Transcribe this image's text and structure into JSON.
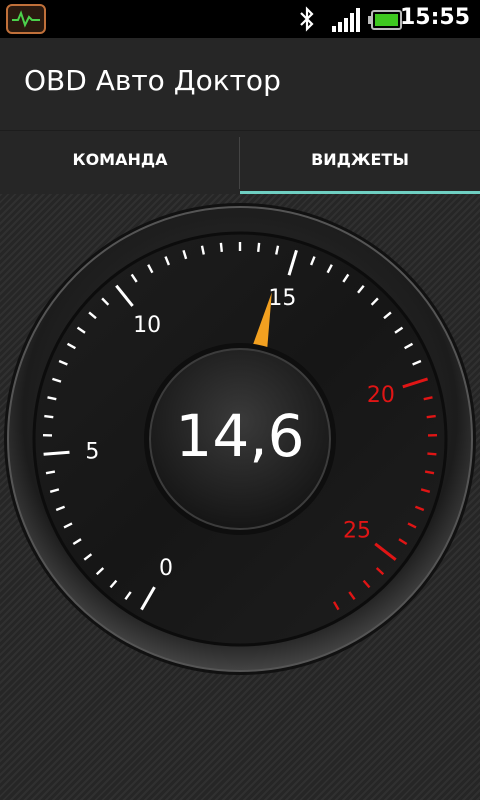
{
  "status_bar": {
    "time": "15:55",
    "icons": [
      "obd-app-icon",
      "bluetooth-icon",
      "signal-icon",
      "battery-icon"
    ],
    "battery_color": "#3ec71f"
  },
  "app_bar": {
    "title": "OBD Авто Доктор"
  },
  "tabs": [
    {
      "label": "КОМАНДА",
      "selected": false
    },
    {
      "label": "ВИДЖЕТЫ",
      "selected": true
    }
  ],
  "colors": {
    "tab_indicator": "#6fcfc2",
    "needle": "#f2a020",
    "redline": "#e01515"
  },
  "gauge": {
    "value_text": "14,6",
    "value": 14.6,
    "min": 0,
    "max": 27,
    "redline_start": 20,
    "labels": [
      {
        "value": 0,
        "text": "0",
        "red": false
      },
      {
        "value": 5,
        "text": "5",
        "red": false
      },
      {
        "value": 10,
        "text": "10",
        "red": false
      },
      {
        "value": 15,
        "text": "15",
        "red": false
      },
      {
        "value": 20,
        "text": "20",
        "red": true
      },
      {
        "value": 25,
        "text": "25",
        "red": true
      }
    ]
  }
}
